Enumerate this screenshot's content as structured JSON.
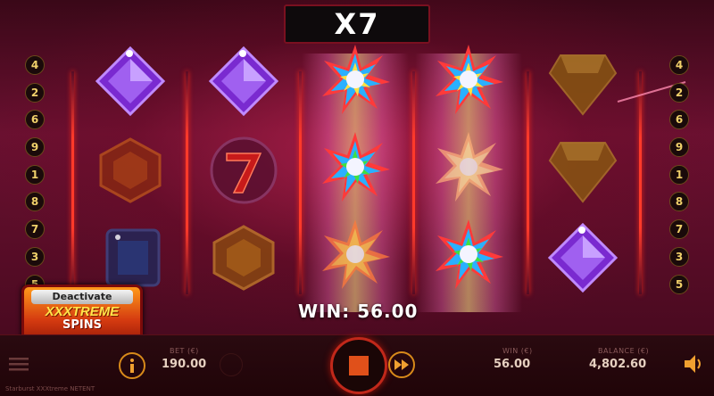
{
  "multiplier": "X7",
  "paylines_left": [
    "4",
    "2",
    "6",
    "9",
    "1",
    "8",
    "7",
    "3",
    "5"
  ],
  "paylines_right": [
    "4",
    "2",
    "6",
    "9",
    "1",
    "8",
    "7",
    "3",
    "5"
  ],
  "win_display": "WIN: 56.00",
  "xxxtreme_button": {
    "deactivate_label": "Deactivate",
    "title": "XXXTREME",
    "subtitle": "SPINS"
  },
  "bottom_bar": {
    "bet_label": "BET (€)",
    "bet_value": "190.00",
    "win_label": "WIN (€)",
    "win_value": "56.00",
    "balance_label": "BALANCE (€)",
    "balance_value": "4,802.60"
  },
  "footer": "Starburst XXXtreme NETENT",
  "reels": [
    [
      "purple-gem",
      "orange-hexagon",
      "blue-gem"
    ],
    [
      "purple-gem",
      "red-seven",
      "orange-hexagon"
    ],
    [
      "starburst-wild",
      "starburst-wild",
      "starburst-wild"
    ],
    [
      "starburst-wild",
      "starburst-wild",
      "starburst-wild"
    ],
    [
      "yellow-gem",
      "yellow-gem",
      "purple-gem"
    ]
  ],
  "colors": {
    "accent_red": "#ff3a2a",
    "gold": "#f0d06a",
    "button_orange": "#ff9a1a"
  }
}
